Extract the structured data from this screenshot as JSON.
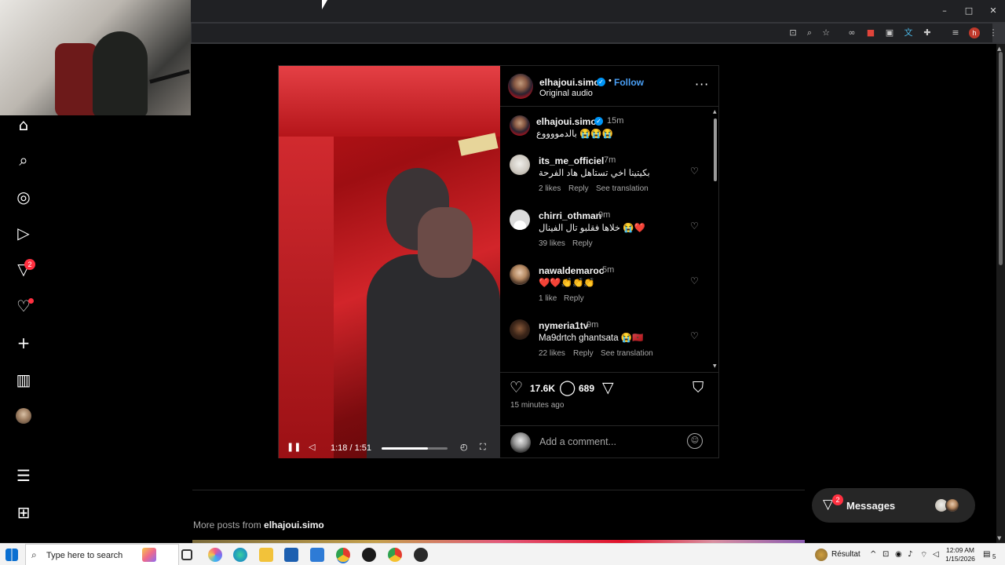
{
  "post": {
    "author": "elhajoui.simo",
    "follow_label": "Follow",
    "audio": "Original audio",
    "caption": {
      "author": "elhajoui.simo",
      "time": "15m",
      "text": "بالدمووووع 😭😭😭"
    },
    "comments": [
      {
        "user": "its_me_officiel",
        "time": "7m",
        "text": "بكيتينا اخي تستاهل هاد الفرحة",
        "likes": "2 likes",
        "reply": "Reply",
        "translate": "See translation"
      },
      {
        "user": "chirri_othman",
        "time": "9m",
        "text": "خلاها فقلبو تال الفينال 😭❤️",
        "likes": "39 likes",
        "reply": "Reply",
        "translate": ""
      },
      {
        "user": "nawaldemaroc",
        "time": "5m",
        "text": "❤️❤️👏👏👏",
        "likes": "1 like",
        "reply": "Reply",
        "translate": ""
      },
      {
        "user": "nymeria1tv",
        "time": "9m",
        "text": "Ma9drtch ghantsata 😭🇲🇦",
        "likes": "22 likes",
        "reply": "Reply",
        "translate": "See translation"
      }
    ],
    "like_count": "17.6K",
    "comment_count": "689",
    "posted_ago": "15 minutes ago",
    "comment_placeholder": "Add a comment...",
    "video": {
      "time": "1:18 / 1:51",
      "progress": 0.703
    }
  },
  "nav": {
    "items": [
      "home-icon",
      "search-icon",
      "explore-icon",
      "reels-icon",
      "direct-icon",
      "notifications-icon",
      "create-icon",
      "dashboard-icon",
      "profile-avatar",
      "menu-icon",
      "also-from-meta-icon"
    ],
    "direct_badge": "2"
  },
  "more_posts": {
    "prefix": "More posts from ",
    "author": "elhajoui.simo"
  },
  "messages": {
    "label": "Messages",
    "badge": "2"
  },
  "taskbar": {
    "search_placeholder": "Type here to search",
    "weather_label": "Résultat",
    "time": "12:09 AM",
    "date": "1/15/2026",
    "notification_count": "5"
  },
  "colors": {
    "accent": "#0095f6",
    "badge": "#ff3040",
    "follow": "#4a9ff5",
    "background": "#000000"
  }
}
